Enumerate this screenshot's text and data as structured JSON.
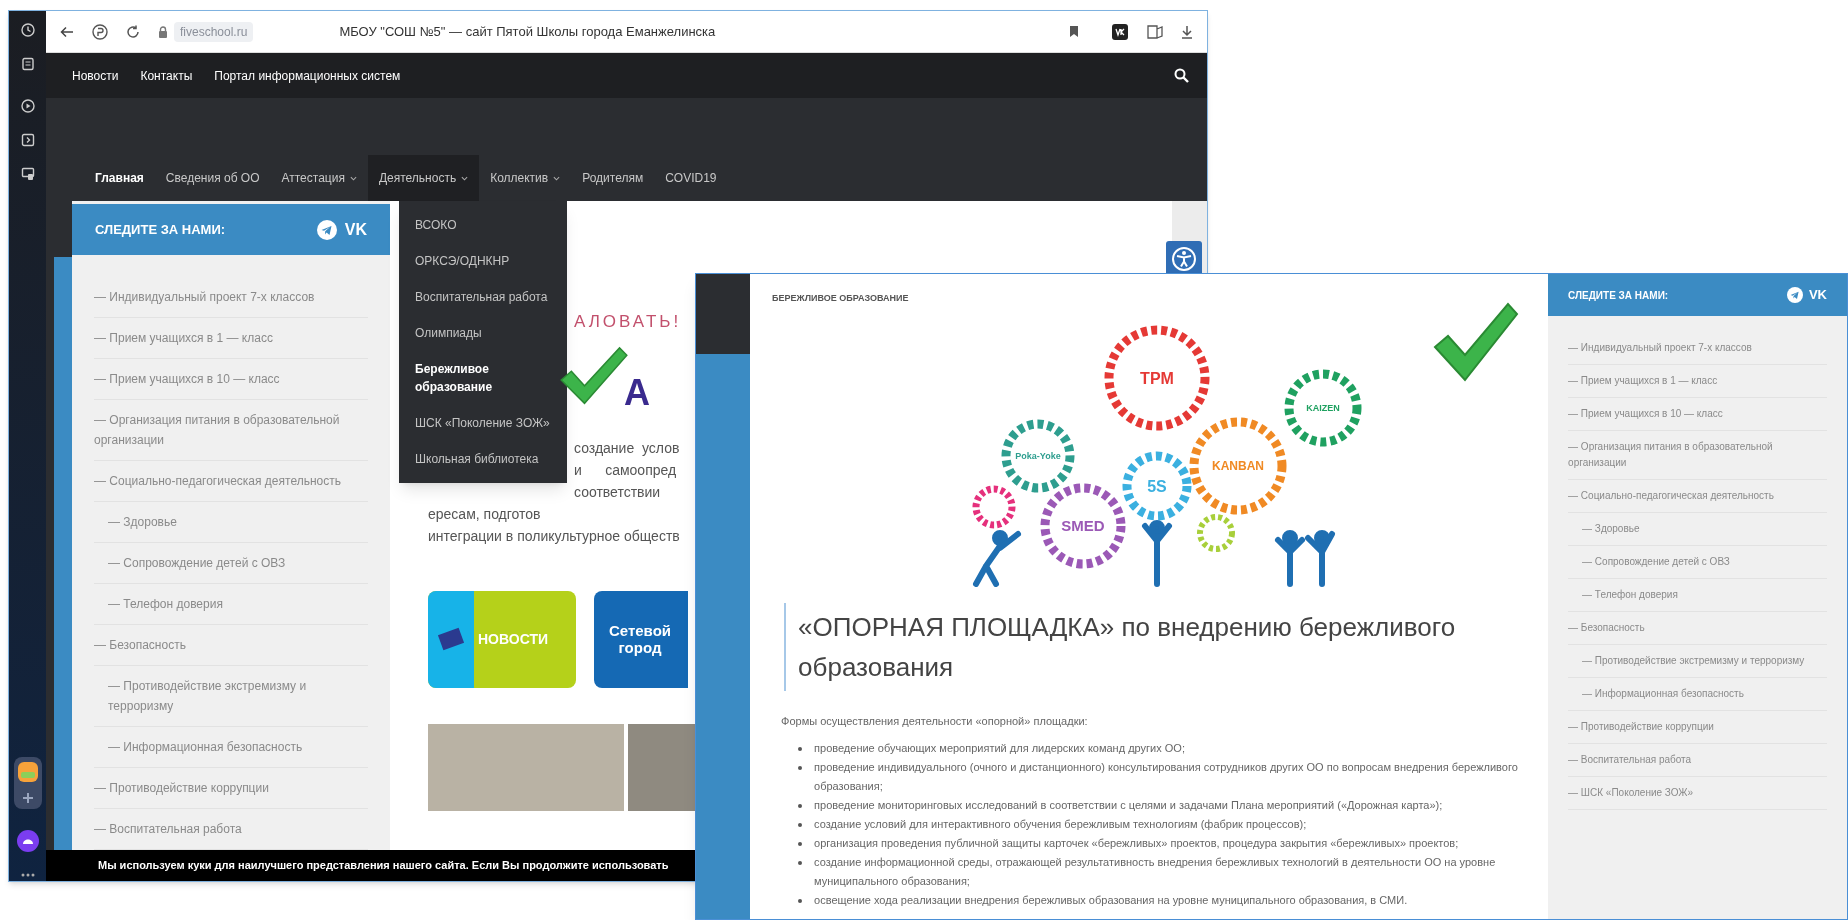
{
  "browser": {
    "url": "fiveschool.ru",
    "title": "МБОУ \"СОШ №5\" — сайт Пятой Школы города Еманжелинска"
  },
  "top_nav": [
    "Новости",
    "Контакты",
    "Портал информационных систем"
  ],
  "main_menu": [
    {
      "label": "Главная",
      "selected": true,
      "expanded": false,
      "has_submenu": false
    },
    {
      "label": "Сведения об ОО",
      "selected": false,
      "expanded": false,
      "has_submenu": false
    },
    {
      "label": "Аттестация",
      "selected": false,
      "expanded": false,
      "has_submenu": true
    },
    {
      "label": "Деятельность",
      "selected": false,
      "expanded": true,
      "has_submenu": true
    },
    {
      "label": "Коллектив",
      "selected": false,
      "expanded": false,
      "has_submenu": true
    },
    {
      "label": "Родителям",
      "selected": false,
      "expanded": false,
      "has_submenu": false
    },
    {
      "label": "COVID19",
      "selected": false,
      "expanded": false,
      "has_submenu": false
    }
  ],
  "dropdown": [
    {
      "label": "ВСОКО",
      "selected": false
    },
    {
      "label": "ОРКСЭ/ОДНКНР",
      "selected": false
    },
    {
      "label": "Воспитательная работа",
      "selected": false
    },
    {
      "label": "Олимпиады",
      "selected": false
    },
    {
      "label": "Бережливое образование",
      "selected": true
    },
    {
      "label": "ШСК «Поколение ЗОЖ»",
      "selected": false
    },
    {
      "label": "Школьная библиотека",
      "selected": false
    }
  ],
  "left_sidebar": {
    "title": "СЛЕДИТЕ ЗА НАМИ:",
    "vk": "VK",
    "items": [
      {
        "label": "— Индивидуальный проект 7-х классов"
      },
      {
        "label": "— Прием учащихся в 1 — класс"
      },
      {
        "label": "— Прием учащихся в 10 — класс"
      },
      {
        "label": "— Организация питания в образовательной организации"
      },
      {
        "label": "— Социально-педагогическая деятельность",
        "children": [
          {
            "label": "— Здоровье"
          },
          {
            "label": "— Сопровождение детей с ОВЗ"
          },
          {
            "label": "— Телефон доверия"
          }
        ]
      },
      {
        "label": "— Безопасность",
        "children": [
          {
            "label": "— Противодействие экстремизму и терроризму"
          },
          {
            "label": "— Информационная безопасность"
          }
        ]
      },
      {
        "label": "— Противодействие коррупции"
      },
      {
        "label": "— Воспитательная работа"
      }
    ]
  },
  "left_content": {
    "welcome": "АЛОВАТЬ!",
    "big_title": "А",
    "paragraph_lines": [
      "создание  услов",
      "и      самоопред",
      "соответствии",
      "ересам, подготов",
      "интеграции в поликультурное обществ"
    ],
    "cards": [
      {
        "kind": "news",
        "label": "НОВОСТИ"
      },
      {
        "kind": "network",
        "label": "Сетевой город"
      }
    ]
  },
  "cookie_notice": "Мы используем куки для наилучшего представления нашего сайта. Если Вы продолжите использовать",
  "right_page": {
    "breadcrumb": "БЕРЕЖЛИВОЕ ОБРАЗОВАНИЕ",
    "gears": [
      {
        "label": "TPM",
        "color": "#e53935"
      },
      {
        "label": "KANBAN",
        "color": "#f08a24"
      },
      {
        "label": "KAIZEN",
        "color": "#1fa160"
      },
      {
        "label": "Poka-Yoke",
        "color": "#2e9e8f"
      },
      {
        "label": "5S",
        "color": "#3bb0e0"
      },
      {
        "label": "SMED",
        "color": "#9b59b6"
      }
    ],
    "heading": "«ОПОРНАЯ ПЛОЩАДКА» по внедрению бережливого образования",
    "intro": "Формы осуществления деятельности «опорной» площадки:",
    "bullets": [
      "проведение обучающих мероприятий для лидерских команд других ОО;",
      "проведение индивидуального (очного и дистанционного) консультирования сотрудников других ОО по вопросам внедрения бережливого образования;",
      "проведение мониторинговых исследований в соответствии с целями и задачами Плана мероприятий («Дорожная карта»);",
      "создание условий для интерактивного обучения бережливым технологиям (фабрик процессов);",
      "организация проведения публичной защиты карточек «бережливых» проектов, процедура закрытия «бережливых» проектов;",
      "создание информационной среды, отражающей результативность внедрения бережливых технологий в деятельности ОО на уровне муниципального образования;",
      "освещение хода реализации внедрения бережливых образования на уровне муниципального образования, в СМИ."
    ]
  },
  "right_sidebar": {
    "title": "СЛЕДИТЕ ЗА НАМИ:",
    "vk": "VK",
    "items": [
      {
        "label": "— Индивидуальный проект 7-х классов"
      },
      {
        "label": "— Прием учащихся в 1 — класс"
      },
      {
        "label": "— Прием учащихся в 10 — класс"
      },
      {
        "label": "— Организация питания в образовательной организации"
      },
      {
        "label": "— Социально-педагогическая деятельность",
        "children": [
          {
            "label": "— Здоровье"
          },
          {
            "label": "— Сопровождение детей с ОВЗ"
          },
          {
            "label": "— Телефон доверия"
          }
        ]
      },
      {
        "label": "— Безопасность",
        "children": [
          {
            "label": "— Противодействие экстремизму и терроризму"
          },
          {
            "label": "— Информационная безопасность"
          }
        ]
      },
      {
        "label": "— Противодействие коррупции"
      },
      {
        "label": "— Воспитательная работа"
      },
      {
        "label": "— ШСК «Поколение ЗОЖ»"
      }
    ]
  }
}
